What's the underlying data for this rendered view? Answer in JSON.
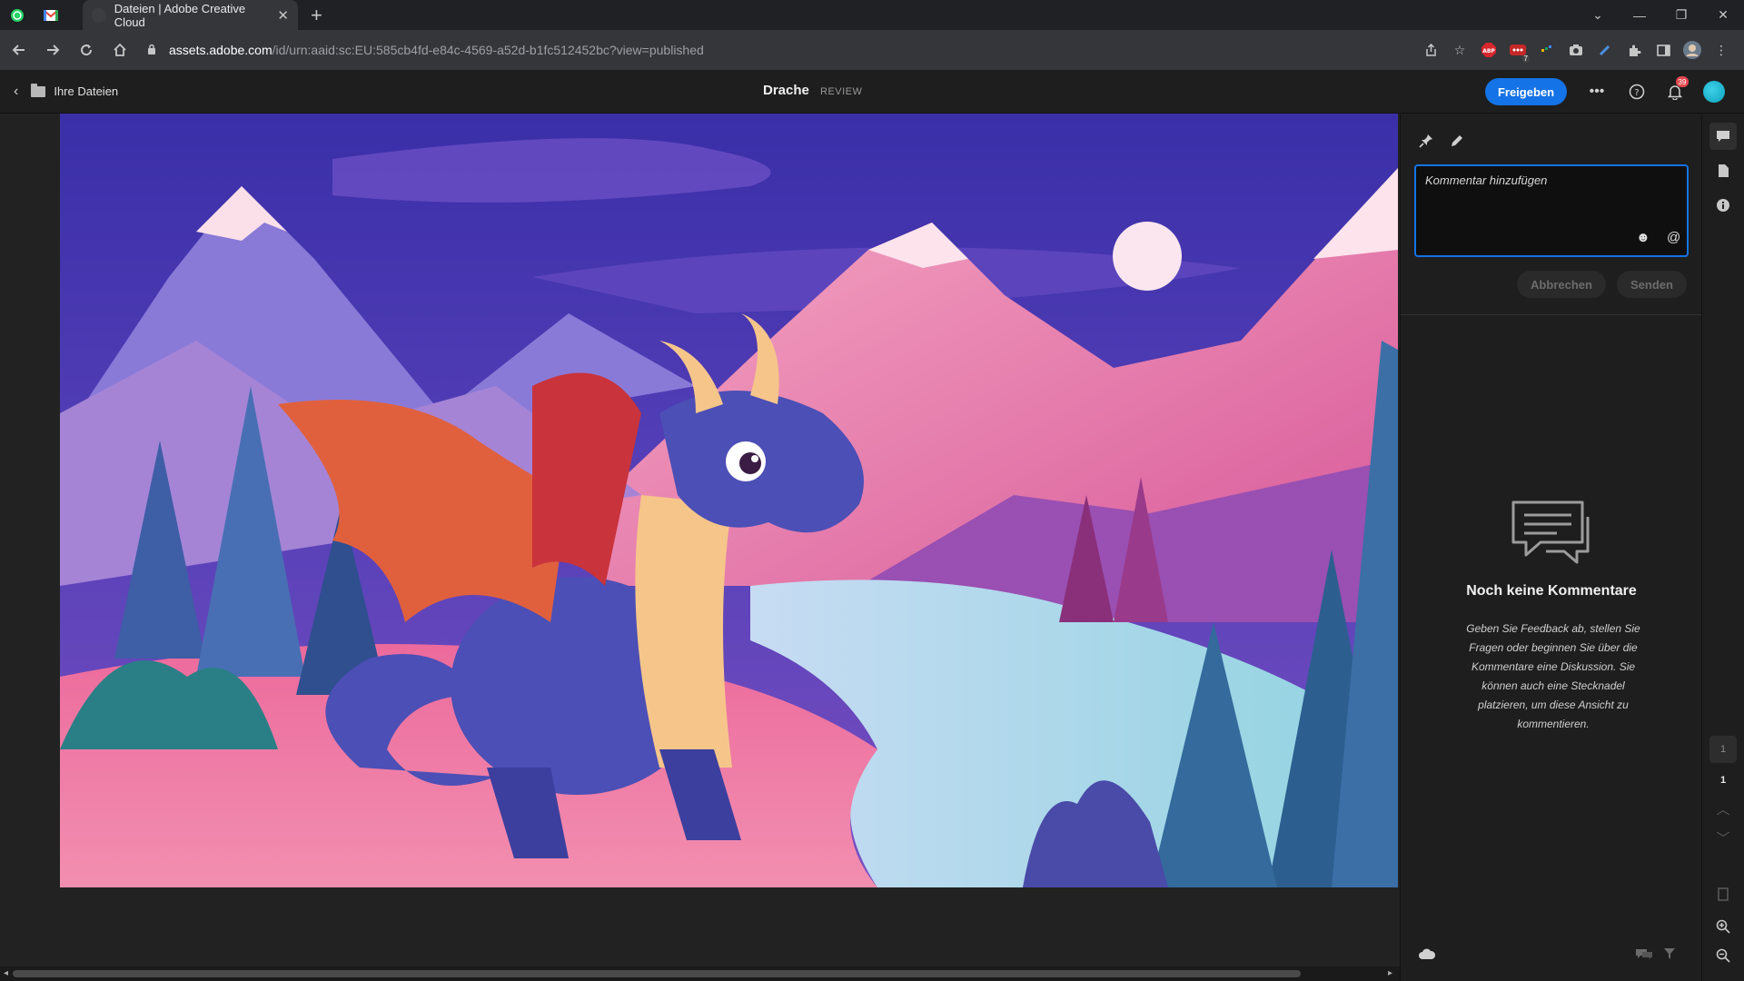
{
  "browser": {
    "tab_title": "Dateien | Adobe Creative Cloud",
    "tab_close": "✕",
    "new_tab": "+",
    "url_host": "assets.adobe.com",
    "url_path": "/id/urn:aaid:sc:EU:585cb4fd-e84c-4569-a52d-b1fc512452bc?view=published",
    "window_controls": [
      "⌄",
      "—",
      "❐",
      "✕"
    ],
    "extension_badge": "7"
  },
  "header": {
    "back_label": "Ihre Dateien",
    "title": "Drache",
    "status": "REVIEW",
    "share_label": "Freigeben",
    "more_icon": "•••",
    "help_icon": "?",
    "notifications_count": "39"
  },
  "comments": {
    "placeholder": "Kommentar hinzufügen",
    "emoji_icon": "☻",
    "mention_icon": "@",
    "cancel_label": "Abbrechen",
    "send_label": "Senden",
    "empty_title": "Noch keine Kommentare",
    "empty_description": "Geben Sie Feedback ab, stellen Sie Fragen oder beginnen Sie über die Kommentare eine Diskussion. Sie können auch eine Stecknadel platzieren, um diese Ansicht zu kommentieren."
  },
  "rail": {
    "page_indicator": "1",
    "page_current": "1"
  },
  "colors": {
    "accent": "#1473e6",
    "background": "#1e1e1e",
    "badge": "#e34850"
  },
  "icons": [
    "whatsapp-icon",
    "gmail-icon",
    "back-arrow-icon",
    "forward-arrow-icon",
    "reload-icon",
    "home-icon",
    "lock-icon",
    "share-page-icon",
    "star-icon",
    "adblock-icon",
    "extensions-icon",
    "pin-icon",
    "pencil-icon",
    "emoji-icon",
    "at-icon",
    "speech-bubbles-icon",
    "cloud-icon",
    "filter-icon",
    "comments-icon",
    "file-icon",
    "info-icon",
    "zoom-in-icon",
    "zoom-out-icon"
  ]
}
